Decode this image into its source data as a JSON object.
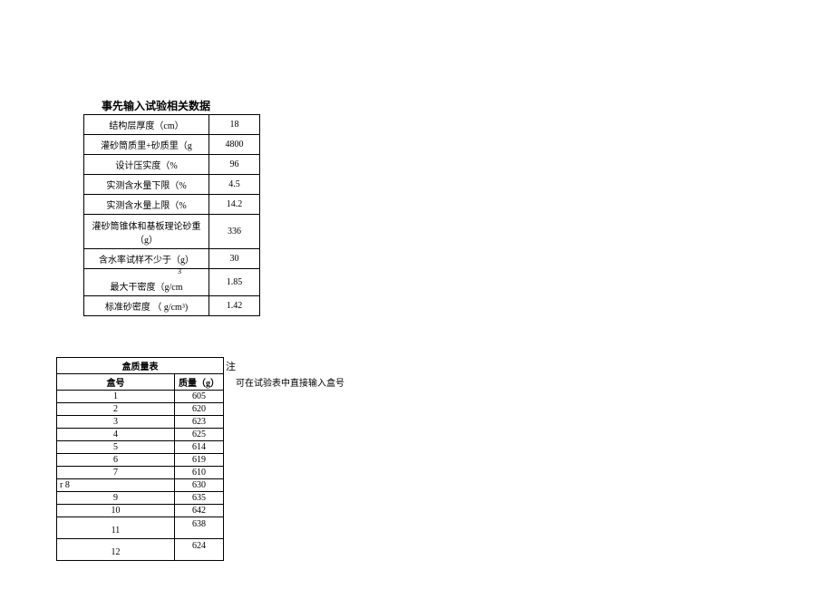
{
  "title": "事先输入试验相关数据",
  "params": [
    {
      "label": "结构层厚度（cm）",
      "value": "18",
      "cls": ""
    },
    {
      "label": "灌砂筒质里+砂质里（g",
      "value": "4800",
      "cls": ""
    },
    {
      "label": "设计压实度（%",
      "value": "96",
      "cls": ""
    },
    {
      "label": "实测含水量下限（%",
      "value": "4.5",
      "cls": ""
    },
    {
      "label": "实测含水量上限（%",
      "value": "14.2",
      "cls": ""
    },
    {
      "label": "灌砂筒锥体和基板理论砂重（g）",
      "value": "336",
      "cls": "tall"
    },
    {
      "label": "含水率试样不少于（g）",
      "value": "30",
      "cls": ""
    },
    {
      "label": "最大干密度（g/cm³）",
      "value": "1.85",
      "cls": "med"
    },
    {
      "label": "标准砂密度 （ g/cm³)",
      "value": "1.42",
      "cls": ""
    }
  ],
  "boxTable": {
    "header": "盒质量表",
    "col1": "盒号",
    "col2": "质量（g）",
    "rows": [
      {
        "no": "1",
        "mass": "605",
        "special": ""
      },
      {
        "no": "2",
        "mass": "620",
        "special": ""
      },
      {
        "no": "3",
        "mass": "623",
        "special": ""
      },
      {
        "no": "4",
        "mass": "625",
        "special": ""
      },
      {
        "no": "5",
        "mass": "614",
        "special": ""
      },
      {
        "no": "6",
        "mass": "619",
        "special": ""
      },
      {
        "no": "7",
        "mass": "610",
        "special": ""
      },
      {
        "no": "r 8",
        "mass": "630",
        "special": "r8"
      },
      {
        "no": "9",
        "mass": "635",
        "special": ""
      },
      {
        "no": "10",
        "mass": "642",
        "special": ""
      },
      {
        "no": "11",
        "mass": "638",
        "special": "tall"
      },
      {
        "no": "12",
        "mass": "624",
        "special": "tall"
      }
    ]
  },
  "note": {
    "label": "注",
    "text": "可在试验表中直接输入盒号"
  }
}
